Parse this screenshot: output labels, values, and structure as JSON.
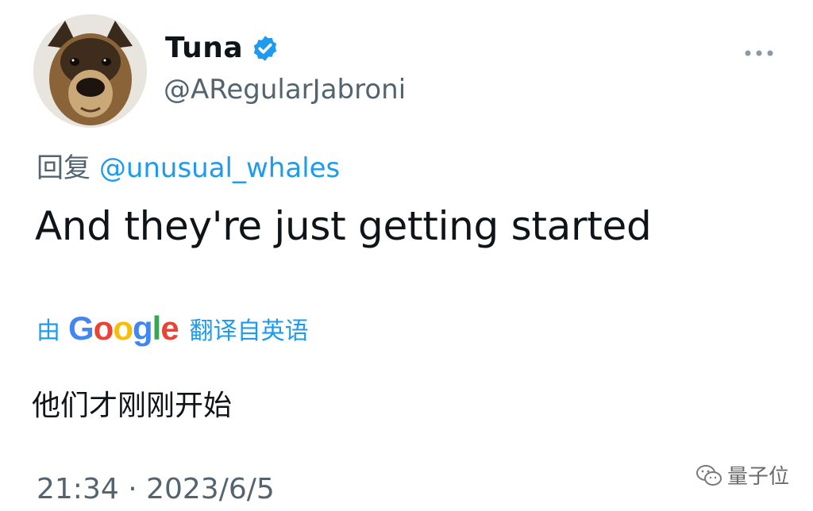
{
  "tweet": {
    "display_name": "Tuna",
    "handle": "@ARegularJabroni",
    "more_icon": "more-horizontal-icon",
    "verified_icon": "verified-badge-icon",
    "reply_prefix": "回复",
    "reply_to": "@unusual_whales",
    "text": "And they're just getting started",
    "translation": {
      "by_label": "由",
      "service_letters": [
        "G",
        "o",
        "o",
        "g",
        "l",
        "e"
      ],
      "from_label": "翻译自英语",
      "text": "他们才刚刚开始"
    },
    "timestamp": "21:34 · 2023/6/5"
  },
  "watermark": {
    "text": "量子位",
    "icon": "wechat-icon"
  },
  "colors": {
    "accent": "#1d9bf0",
    "secondary_text": "#536471",
    "primary_text": "#0f1419",
    "google_blue": "#4285f4",
    "google_red": "#ea4335",
    "google_yellow": "#fbbc05",
    "google_green": "#34a853"
  }
}
